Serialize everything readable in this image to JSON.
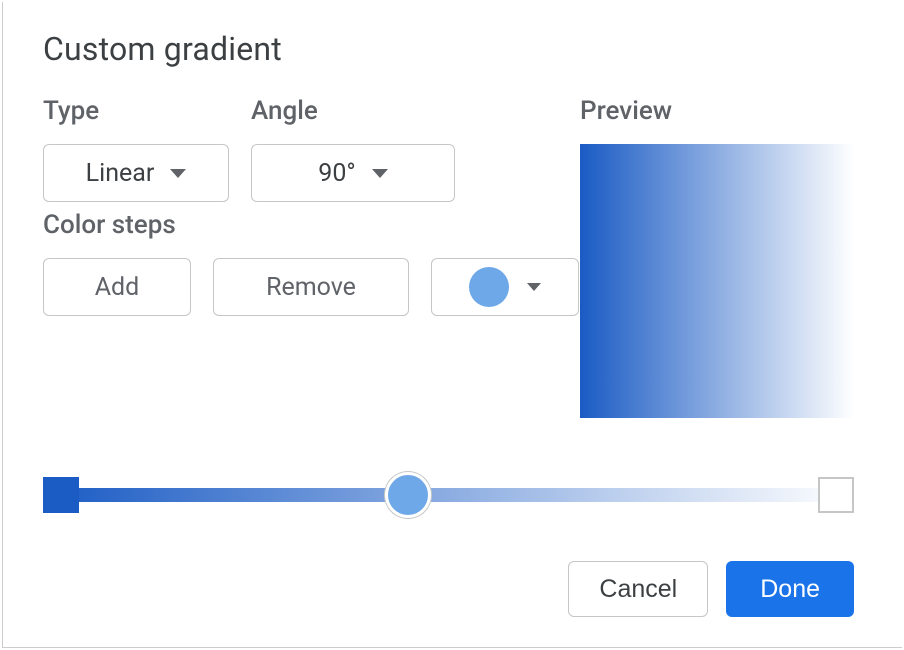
{
  "title": "Custom gradient",
  "type": {
    "label": "Type",
    "value": "Linear"
  },
  "angle": {
    "label": "Angle",
    "value": "90°"
  },
  "preview": {
    "label": "Preview"
  },
  "colorSteps": {
    "label": "Color steps",
    "addLabel": "Add",
    "removeLabel": "Remove",
    "selectedColor": "#6ea8e8"
  },
  "gradient": {
    "startColor": "#1a5bc4",
    "endColor": "#ffffff",
    "sliderPositionPct": 45
  },
  "footer": {
    "cancel": "Cancel",
    "done": "Done"
  }
}
